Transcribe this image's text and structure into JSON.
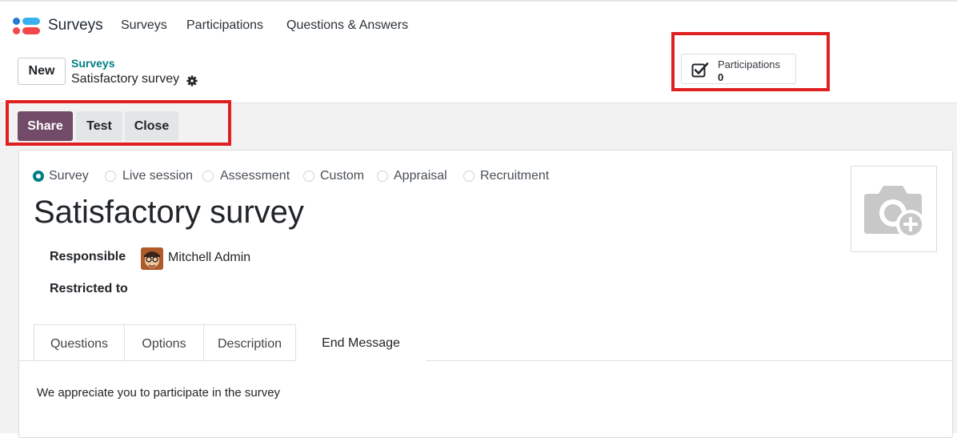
{
  "navbar": {
    "app_name": "Surveys",
    "menu": [
      "Surveys",
      "Participations",
      "Questions & Answers"
    ]
  },
  "control_panel": {
    "new_label": "New",
    "breadcrumb_parent": "Surveys",
    "breadcrumb_current": "Satisfactory survey",
    "stat_button": {
      "label": "Participations",
      "value": "0"
    }
  },
  "statusbar": {
    "share": "Share",
    "test": "Test",
    "close": "Close"
  },
  "form": {
    "survey_types": [
      "Survey",
      "Live session",
      "Assessment",
      "Custom",
      "Appraisal",
      "Recruitment"
    ],
    "selected_type": "Survey",
    "title": "Satisfactory survey",
    "responsible_label": "Responsible",
    "responsible_value": "Mitchell Admin",
    "restricted_label": "Restricted to",
    "tabs": [
      "Questions",
      "Options",
      "Description",
      "End Message"
    ],
    "active_tab": "End Message",
    "end_message": "We appreciate you to participate in the survey"
  },
  "colors": {
    "primary": "#714b67",
    "link": "#017e84",
    "highlight": "#e02020"
  },
  "icons": {
    "gear": "gear-icon",
    "stat": "checkbox-check-icon",
    "image": "camera-plus-icon"
  }
}
